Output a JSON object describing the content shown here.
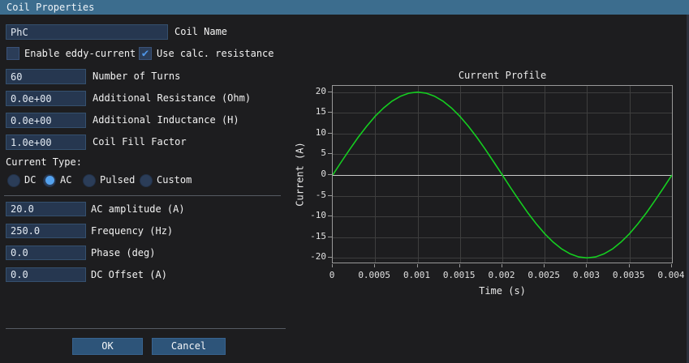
{
  "window": {
    "title": "Coil Properties"
  },
  "icons": {
    "checkbox_check": "✔"
  },
  "form": {
    "coil_name": {
      "value": "PhC",
      "label": "Coil Name"
    },
    "checkboxes": [
      {
        "label": "Enable eddy-current",
        "checked": false
      },
      {
        "label": "Use calc. resistance",
        "checked": true
      }
    ],
    "fields": [
      {
        "value": "60",
        "label": "Number of Turns"
      },
      {
        "value": "0.0e+00",
        "label": "Additional Resistance (Ohm)"
      },
      {
        "value": "0.0e+00",
        "label": "Additional Inductance (H)"
      },
      {
        "value": "1.0e+00",
        "label": "Coil Fill Factor"
      }
    ],
    "current_type": {
      "label": "Current Type:",
      "options": [
        {
          "label": "DC",
          "selected": false
        },
        {
          "label": "AC",
          "selected": true
        },
        {
          "label": "Pulsed",
          "selected": false
        },
        {
          "label": "Custom",
          "selected": false
        }
      ]
    },
    "ac_fields": [
      {
        "value": "20.0",
        "label": "AC amplitude (A)"
      },
      {
        "value": "250.0",
        "label": "Frequency (Hz)"
      },
      {
        "value": "0.0",
        "label": "Phase (deg)"
      },
      {
        "value": "0.0",
        "label": "DC Offset (A)"
      }
    ],
    "buttons": {
      "ok": "OK",
      "cancel": "Cancel"
    }
  },
  "colors": {
    "titlebar": "#3c6d8e",
    "accent_blue": "#54a2ee",
    "button": "#2d5479",
    "background": "#1d1d1f",
    "curve_green": "#15cd20"
  },
  "chart_data": {
    "type": "line",
    "title": "Current Profile",
    "xlabel": "Time (s)",
    "ylabel": "Current (A)",
    "grid": true,
    "legend": "none",
    "x_start": 0,
    "x_end": 0.004,
    "values": [
      0,
      3.129,
      6.18,
      9.08,
      11.756,
      14.142,
      16.18,
      17.82,
      19.021,
      19.754,
      20,
      19.754,
      19.021,
      17.82,
      16.18,
      14.142,
      11.756,
      9.08,
      6.18,
      3.129,
      0,
      -3.129,
      -6.18,
      -9.08,
      -11.756,
      -14.142,
      -16.18,
      -17.82,
      -19.021,
      -19.754,
      -20,
      -19.754,
      -19.021,
      -17.82,
      -16.18,
      -14.142,
      -11.756,
      -9.08,
      -6.18,
      -3.129,
      0
    ],
    "x_ticks": [
      0,
      0.0005,
      0.001,
      0.0015,
      0.002,
      0.0025,
      0.003,
      0.0035,
      0.004
    ],
    "x_tick_labels": [
      "0",
      "0.0005",
      "0.001",
      "0.0015",
      "0.002",
      "0.0025",
      "0.003",
      "0.0035",
      "0.004"
    ],
    "y_ticks": [
      20,
      15,
      10,
      5,
      0,
      -5,
      -10,
      -15,
      -20
    ],
    "xlim": [
      0,
      0.00402
    ],
    "ylim": [
      -21.5,
      21.5
    ],
    "line_color": "#15cd20"
  }
}
